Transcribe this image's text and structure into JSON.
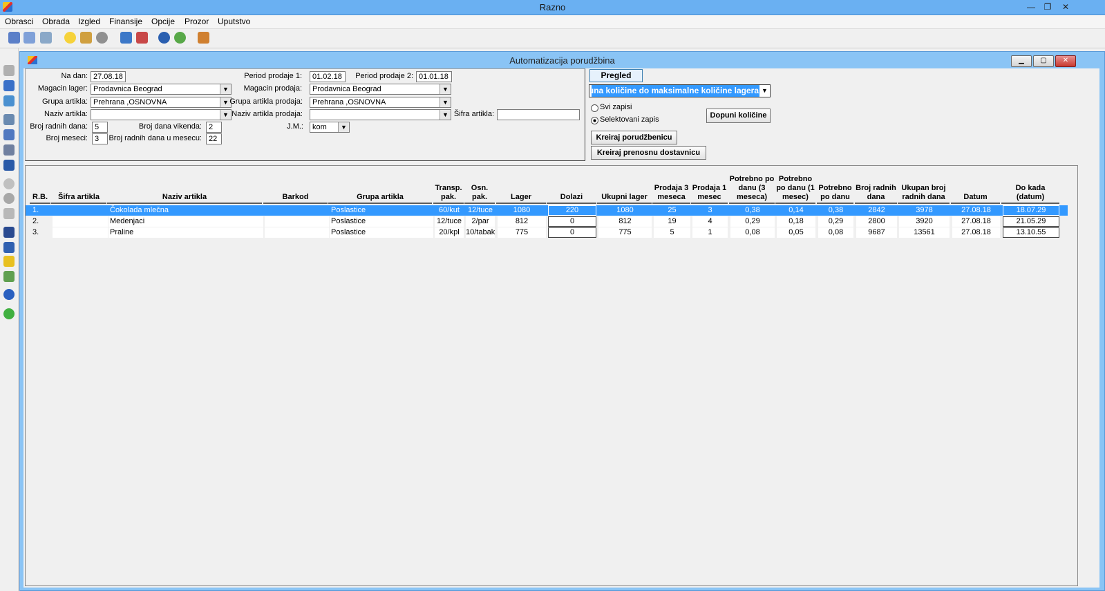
{
  "app_title": "Razno",
  "menu": [
    "Obrasci",
    "Obrada",
    "Izgled",
    "Finansije",
    "Opcije",
    "Prozor",
    "Uputstvo"
  ],
  "window": {
    "title": "Automatizacija porudžbina"
  },
  "form": {
    "na_dan_label": "Na dan:",
    "na_dan": "27.08.18",
    "period1_label": "Period prodaje 1:",
    "period1": "01.02.18",
    "period2_label": "Period prodaje 2:",
    "period2": "01.01.18",
    "magacin_lager_label": "Magacin lager:",
    "magacin_lager": "Prodavnica Beograd",
    "magacin_prodaja_label": "Magacin prodaja:",
    "magacin_prodaja": "Prodavnica Beograd",
    "grupa_label": "Grupa artikla:",
    "grupa": "Prehrana ,OSNOVNA",
    "grupa_prodaja_label": "Grupa artikla prodaja:",
    "grupa_prodaja": "Prehrana ,OSNOVNA",
    "naziv_label": "Naziv artikla:",
    "naziv": "",
    "naziv_prodaja_label": "Naziv artikla prodaja:",
    "naziv_prodaja": "",
    "sifra_label": "Šifra artikla:",
    "sifra": "",
    "radni_dani_label": "Broj radnih dana:",
    "radni_dani": "5",
    "vikend_label": "Broj dana vikenda:",
    "vikend": "2",
    "jm_label": "J.M.:",
    "jm": "kom",
    "meseci_label": "Broj meseci:",
    "meseci": "3",
    "radni_mesec_label": "Broj radnih dana u mesecu:",
    "radni_mesec": "22"
  },
  "right": {
    "pregled": "Pregled",
    "mode_select": "puna količine do maksimalne količine lagera",
    "radio_svi": "Svi zapisi",
    "radio_selektovani": "Selektovani zapis",
    "dopuni": "Dopuni količine",
    "kreiraj_porudzbenicu": "Kreiraj porudžbenicu",
    "kreiraj_dostavnicu": "Kreiraj prenosnu dostavnicu"
  },
  "table": {
    "headers": [
      "R.B.",
      "Šifra artikla",
      "Naziv artikla",
      "Barkod",
      "Grupa artikla",
      "Transp. pak.",
      "Osn. pak.",
      "Lager",
      "Dolazi",
      "Ukupni lager",
      "Prodaja 3 meseca",
      "Prodaja 1 mesec",
      "Potrebno po danu (3 meseca)",
      "Potrebno po danu (1 mesec)",
      "Potrebno po danu",
      "Broj radnih dana",
      "Ukupan broj radnih dana",
      "Datum",
      "Do kada (datum)"
    ],
    "rows": [
      [
        "1.",
        "",
        "Čokolada mlečna",
        "",
        "Poslastice",
        "60/kut",
        "12/tuce",
        "1080",
        "220",
        "1080",
        "25",
        "3",
        "0,38",
        "0,14",
        "0,38",
        "2842",
        "3978",
        "27.08.18",
        "18.07.29"
      ],
      [
        "2.",
        "",
        "Medenjaci",
        "",
        "Poslastice",
        "12/tuce",
        "2/par",
        "812",
        "0",
        "812",
        "19",
        "4",
        "0,29",
        "0,18",
        "0,29",
        "2800",
        "3920",
        "27.08.18",
        "21.05.29"
      ],
      [
        "3.",
        "",
        "Praline",
        "",
        "Poslastice",
        "20/kpl",
        "10/tabak",
        "775",
        "0",
        "775",
        "5",
        "1",
        "0,08",
        "0,05",
        "0,08",
        "9687",
        "13561",
        "27.08.18",
        "13.10.55"
      ]
    ]
  }
}
